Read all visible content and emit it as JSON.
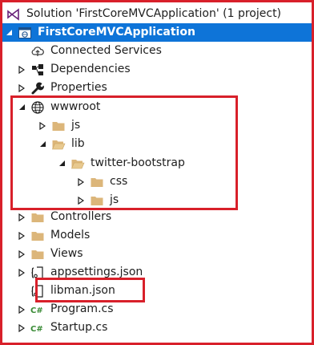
{
  "solution": {
    "label": "Solution 'FirstCoreMVCApplication' (1 project)"
  },
  "project": {
    "label": "FirstCoreMVCApplication"
  },
  "items": {
    "connected_services": "Connected Services",
    "dependencies": "Dependencies",
    "properties": "Properties",
    "wwwroot": "wwwroot",
    "wwwroot_js": "js",
    "lib": "lib",
    "twitter_bootstrap": "twitter-bootstrap",
    "tb_css": "css",
    "tb_js": "js",
    "controllers": "Controllers",
    "models": "Models",
    "views": "Views",
    "appsettings": "appsettings.json",
    "libman": "libman.json",
    "program": "Program.cs",
    "startup": "Startup.cs"
  },
  "colors": {
    "selection_bg": "#0e74d8",
    "highlight_border": "#d8202a",
    "folder": "#dcb67a",
    "csharp_icon": "#388a34"
  },
  "icons": {
    "solution": "visual-studio-solution-icon",
    "project": "web-project-icon",
    "connected_services": "cloud-connected-services-icon",
    "dependencies": "dependencies-icon",
    "properties": "wrench-icon",
    "wwwroot": "globe-icon",
    "folder": "folder-icon",
    "json": "json-file-icon",
    "csharp": "csharp-file-icon"
  }
}
